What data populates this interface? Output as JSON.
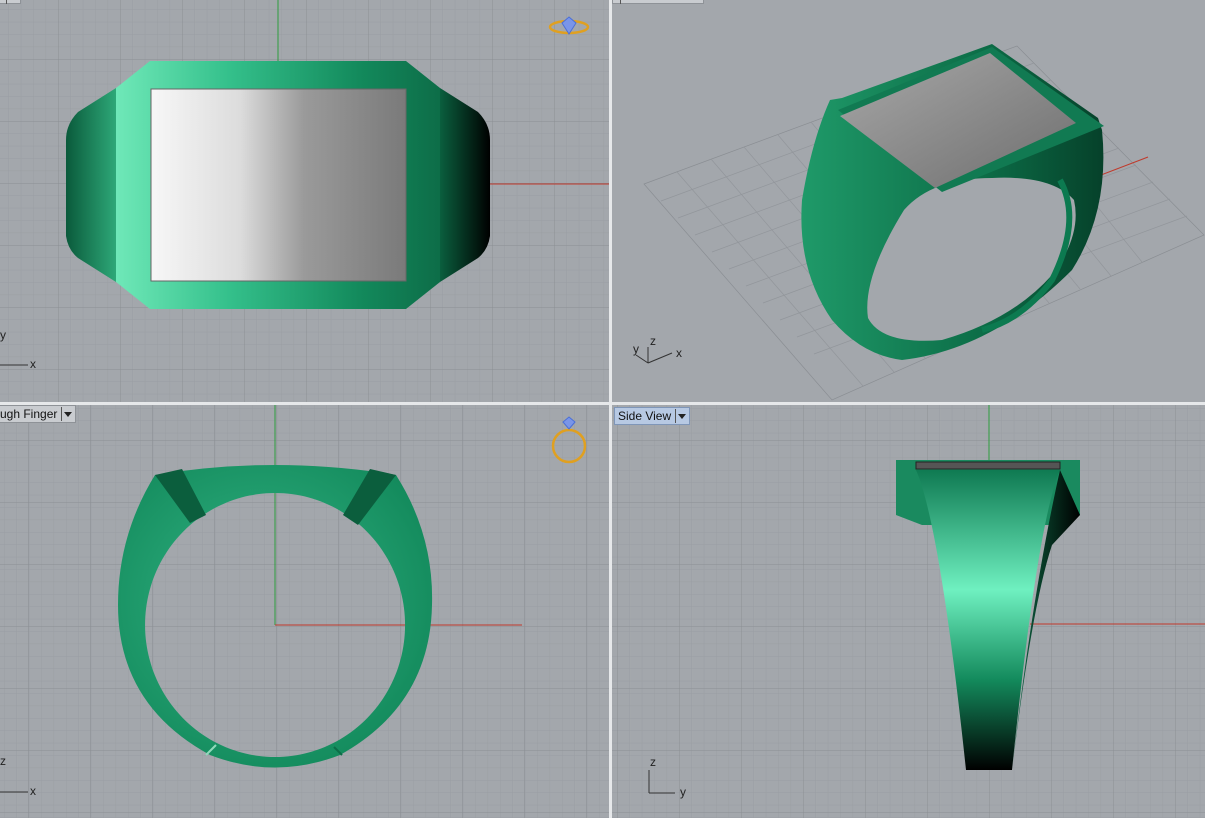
{
  "viewports": {
    "top_left": {
      "label": "",
      "axes": {
        "a": "y",
        "b": "x"
      }
    },
    "top_right": {
      "label": "",
      "axes": {
        "a": "y",
        "b": "z",
        "c": "x"
      }
    },
    "bottom_left": {
      "label": "ugh Finger",
      "axes": {
        "a": "z",
        "b": "x"
      }
    },
    "bottom_right": {
      "label": "Side View",
      "axes": {
        "a": "z",
        "b": "y"
      }
    }
  },
  "colors": {
    "viewport_bg": "#a3a7ac",
    "grid_minor": "#999da2",
    "grid_major": "#8a8e93",
    "x_axis": "#c0392b",
    "y_axis": "#2e9e3e",
    "ring_green": "#1a8a5f",
    "top_plate": "#9a9a9a",
    "active_label_bg": "#b7c9e3",
    "icon_gold": "#e0a020",
    "icon_blue": "#4a6fd8"
  },
  "icons": [
    "ring-gem-icon",
    "ring-upright-icon",
    "viewport-menu-icon"
  ]
}
